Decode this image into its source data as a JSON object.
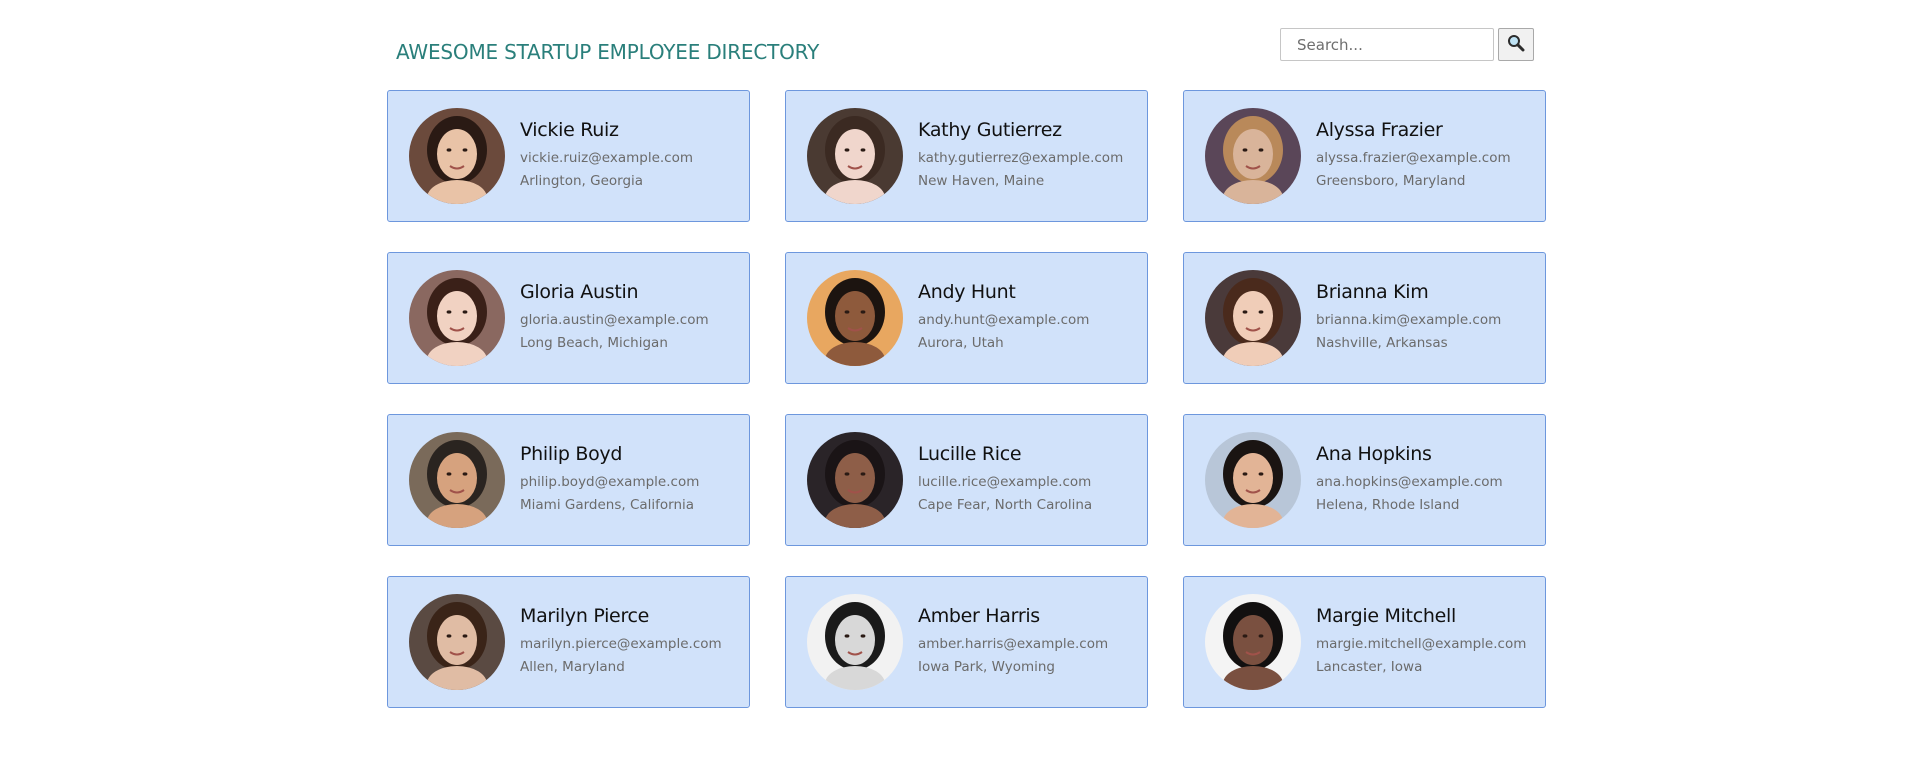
{
  "header": {
    "title": "AWESOME STARTUP EMPLOYEE DIRECTORY",
    "search_placeholder": "Search...",
    "search_icon": "magnifier-icon"
  },
  "employees": [
    {
      "name": "Vickie Ruiz",
      "email": "vickie.ruiz@example.com",
      "location": "Arlington, Georgia",
      "bg": "#6b4a3c",
      "skin": "#e9c3a7",
      "hair": "#2a1a14"
    },
    {
      "name": "Kathy Gutierrez",
      "email": "kathy.gutierrez@example.com",
      "location": "New Haven, Maine",
      "bg": "#4a3a32",
      "skin": "#f0d6cc",
      "hair": "#3b2a22"
    },
    {
      "name": "Alyssa Frazier",
      "email": "alyssa.frazier@example.com",
      "location": "Greensboro, Maryland",
      "bg": "#5a4658",
      "skin": "#d9b49a",
      "hair": "#b9895a"
    },
    {
      "name": "Gloria Austin",
      "email": "gloria.austin@example.com",
      "location": "Long Beach, Michigan",
      "bg": "#8a6860",
      "skin": "#f1d2c2",
      "hair": "#3a2018"
    },
    {
      "name": "Andy Hunt",
      "email": "andy.hunt@example.com",
      "location": "Aurora, Utah",
      "bg": "#e8a760",
      "skin": "#8e5a3c",
      "hair": "#1c1410"
    },
    {
      "name": "Brianna Kim",
      "email": "brianna.kim@example.com",
      "location": "Nashville, Arkansas",
      "bg": "#4a3a3a",
      "skin": "#f0cdb8",
      "hair": "#4a2a1c"
    },
    {
      "name": "Philip Boyd",
      "email": "philip.boyd@example.com",
      "location": "Miami Gardens, California",
      "bg": "#7a6a5a",
      "skin": "#d6a27e",
      "hair": "#2a2420"
    },
    {
      "name": "Lucille Rice",
      "email": "lucille.rice@example.com",
      "location": "Cape Fear, North Carolina",
      "bg": "#2a2428",
      "skin": "#8e5e48",
      "hair": "#1a1416"
    },
    {
      "name": "Ana Hopkins",
      "email": "ana.hopkins@example.com",
      "location": "Helena, Rhode Island",
      "bg": "#b8c6d8",
      "skin": "#e2b496",
      "hair": "#1a1412"
    },
    {
      "name": "Marilyn Pierce",
      "email": "marilyn.pierce@example.com",
      "location": "Allen, Maryland",
      "bg": "#5a4a42",
      "skin": "#e0bca4",
      "hair": "#3a2418"
    },
    {
      "name": "Amber Harris",
      "email": "amber.harris@example.com",
      "location": "Iowa Park, Wyoming",
      "bg": "#f2f2f2",
      "skin": "#d8d8d8",
      "hair": "#1a1a1a"
    },
    {
      "name": "Margie Mitchell",
      "email": "margie.mitchell@example.com",
      "location": "Lancaster, Iowa",
      "bg": "#f4f4f4",
      "skin": "#7a5040",
      "hair": "#121010"
    }
  ]
}
